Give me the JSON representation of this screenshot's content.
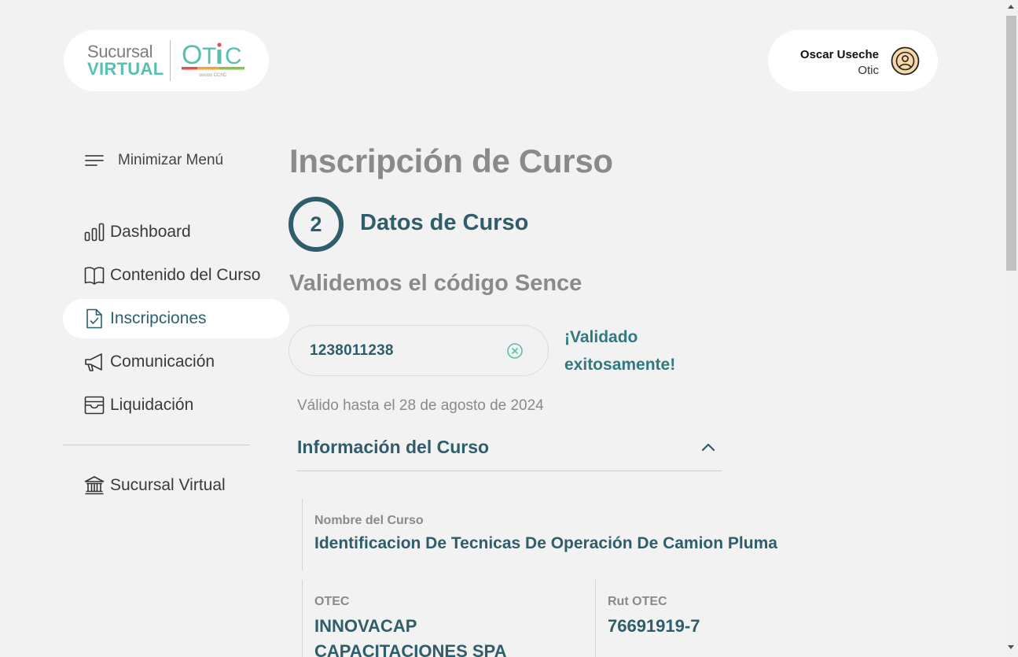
{
  "header": {
    "logo": {
      "line1": "Sucursal",
      "line2": "VIRTUAL",
      "otic_text": "OTIC",
      "otic_subtitle": "socios CChC",
      "colors": {
        "teal": "#5bbfb0",
        "red": "#e4514c",
        "orange": "#f2a33a",
        "green": "#8cc04a"
      }
    },
    "user": {
      "name": "Oscar Useche",
      "role": "Otic"
    }
  },
  "sidebar": {
    "toggle_label": "Minimizar Menú",
    "items": [
      {
        "label": "Dashboard",
        "icon": "bar-chart-icon"
      },
      {
        "label": "Contenido del Curso",
        "icon": "book-icon"
      },
      {
        "label": "Inscripciones",
        "icon": "document-check-icon",
        "active": true
      },
      {
        "label": "Comunicación",
        "icon": "megaphone-icon"
      },
      {
        "label": "Liquidación",
        "icon": "archive-icon"
      }
    ],
    "footer_item": {
      "label": "Sucursal Virtual",
      "icon": "bank-icon"
    }
  },
  "main": {
    "title": "Inscripción de Curso",
    "step": {
      "number": "2",
      "title": "Datos de Curso"
    },
    "section_title": "Validemos el código Sence",
    "sence_code": "1238011238",
    "validation_message": "¡Validado exitosamente!",
    "valid_until": "Válido hasta el 28 de agosto de 2024",
    "info": {
      "title": "Información del Curso",
      "course_name_label": "Nombre del Curso",
      "course_name": "Identificacion De Tecnicas De Operación De Camion Pluma",
      "otec_label": "OTEC",
      "otec": "INNOVACAP CAPACITACIONES SPA",
      "rut_label": "Rut OTEC",
      "rut": "76691919-7"
    }
  },
  "colors": {
    "primary": "#2f5d6a",
    "accent": "#5bbfb0",
    "background": "#f2f2f2"
  }
}
